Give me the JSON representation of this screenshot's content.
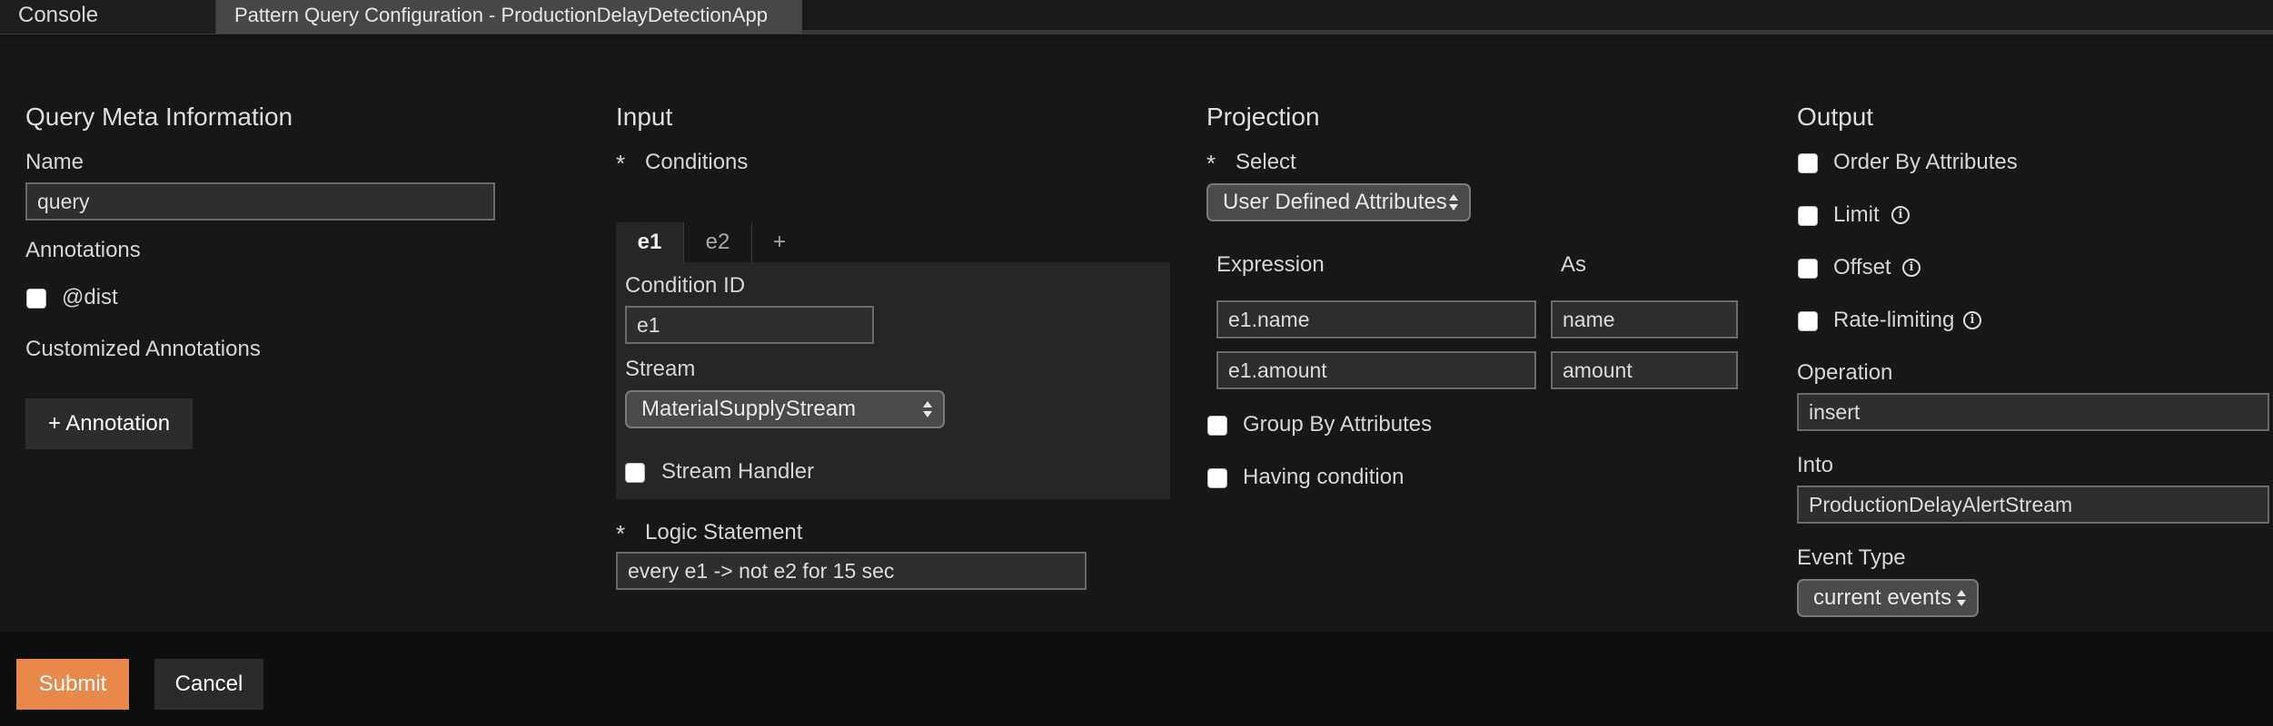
{
  "tabs": {
    "console": "Console",
    "active": "Pattern Query Configuration - ProductionDelayDetectionApp"
  },
  "meta": {
    "heading": "Query Meta Information",
    "name_label": "Name",
    "name_value": "query",
    "annotations_label": "Annotations",
    "dist_label": "@dist",
    "customized_label": "Customized Annotations",
    "add_annotation": "+ Annotation"
  },
  "input": {
    "heading": "Input",
    "required_mark": "*",
    "conditions_label": "Conditions",
    "condition_tabs": [
      "e1",
      "e2",
      "+"
    ],
    "condition_id_label": "Condition ID",
    "condition_id_value": "e1",
    "stream_label": "Stream",
    "stream_value": "MaterialSupplyStream",
    "stream_handler_label": "Stream Handler",
    "logic_label": "Logic Statement",
    "logic_value": "every e1 -> not e2 for 15 sec"
  },
  "projection": {
    "heading": "Projection",
    "select_label": "Select",
    "select_value": "User Defined Attributes",
    "expression_header": "Expression",
    "as_header": "As",
    "rows": [
      {
        "expression": "e1.name",
        "as": "name"
      },
      {
        "expression": "e1.amount",
        "as": "amount"
      }
    ],
    "group_by_label": "Group By Attributes",
    "having_label": "Having condition"
  },
  "output": {
    "heading": "Output",
    "order_by_label": "Order By Attributes",
    "limit_label": "Limit",
    "offset_label": "Offset",
    "rate_limiting_label": "Rate-limiting",
    "info_glyph": "i",
    "operation_label": "Operation",
    "operation_value": "insert",
    "into_label": "Into",
    "into_value": "ProductionDelayAlertStream",
    "event_type_label": "Event Type",
    "event_type_value": "current events"
  },
  "footer": {
    "submit": "Submit",
    "cancel": "Cancel"
  },
  "colors": {
    "submit_bg": "#e8884a",
    "active_tab_bg": "#474747",
    "background": "#171717"
  }
}
